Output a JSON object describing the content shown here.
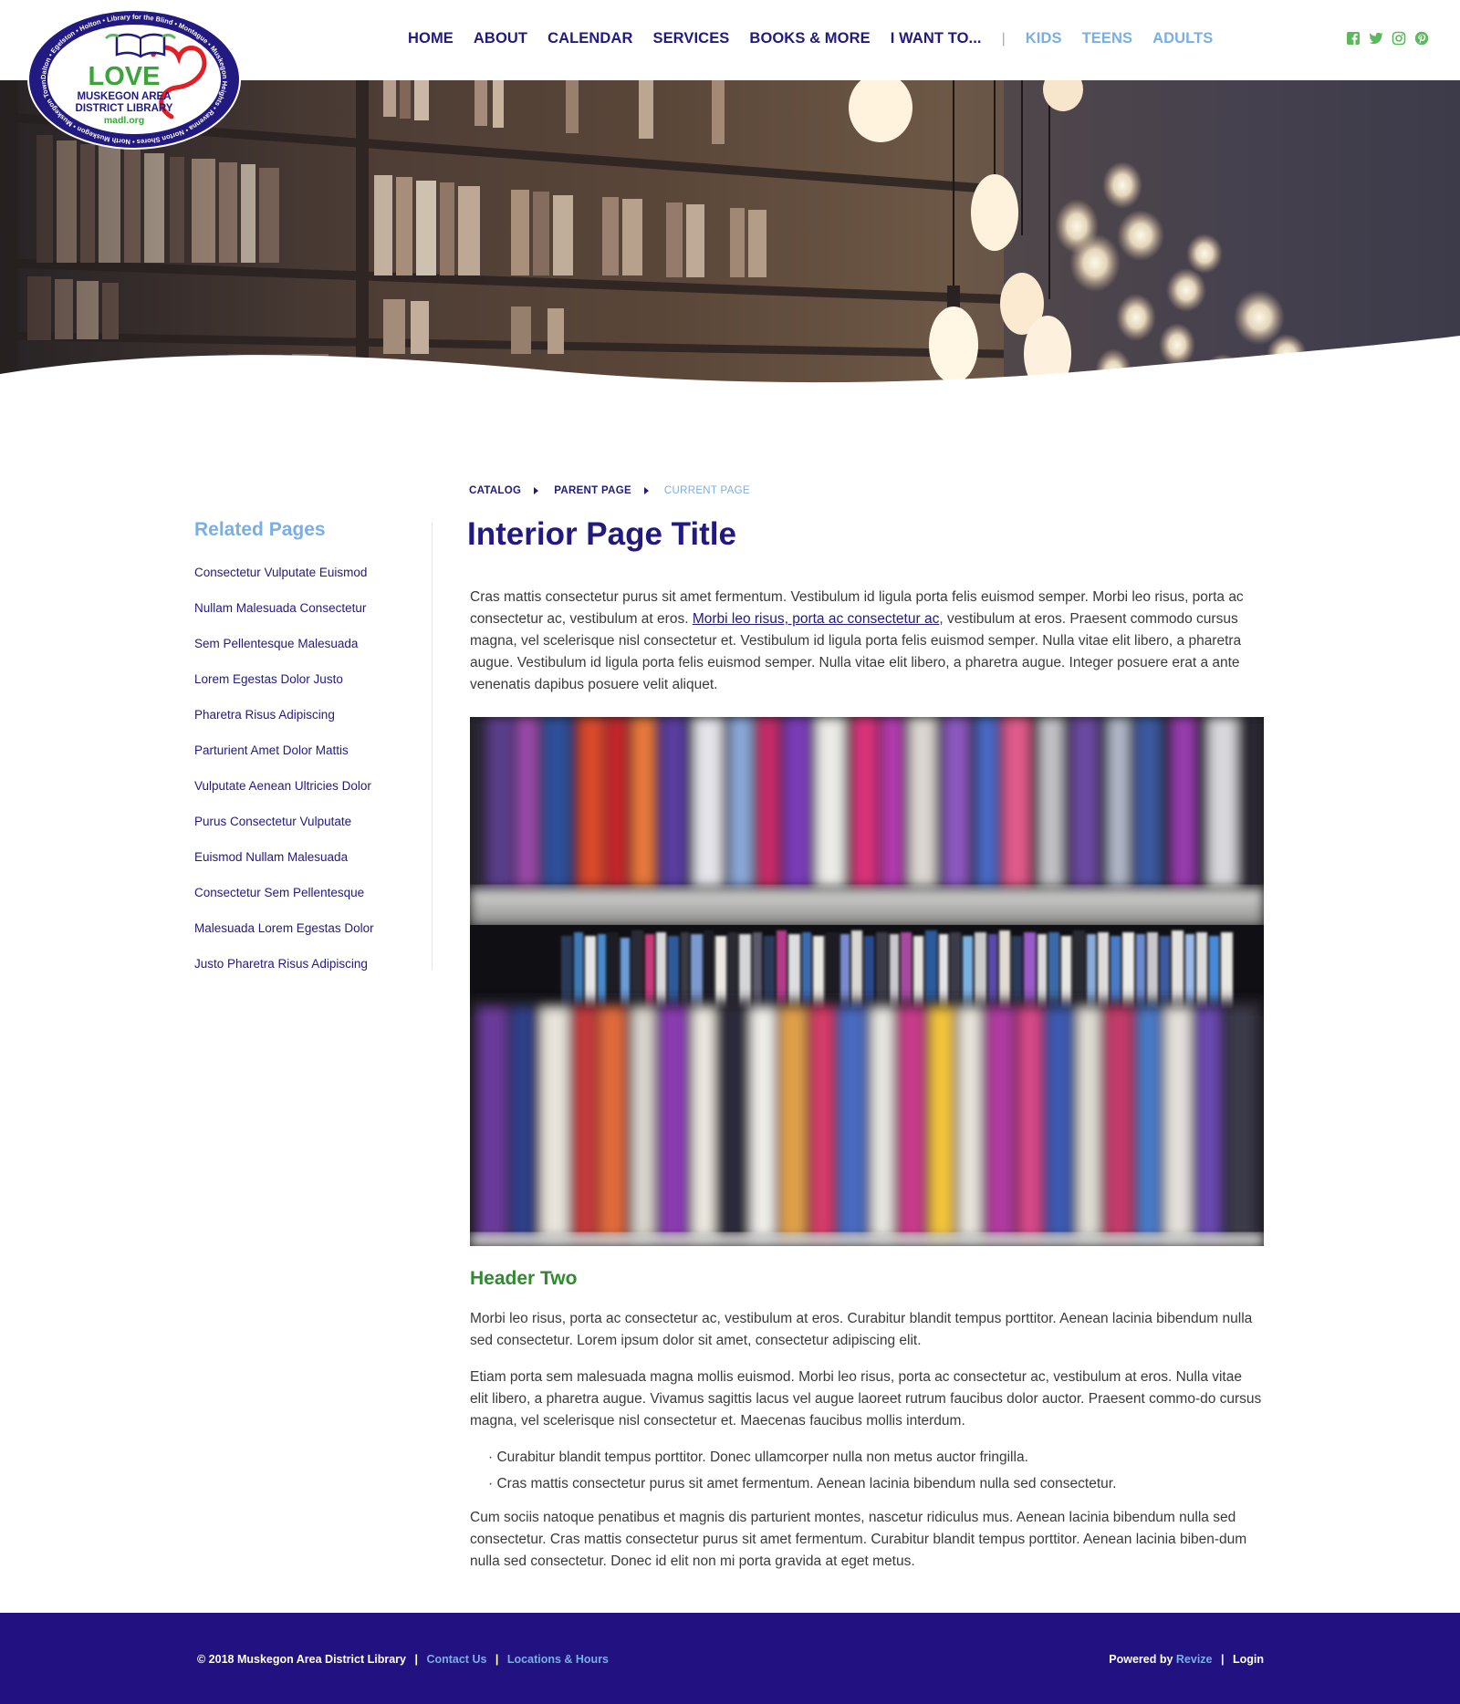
{
  "logo": {
    "main_word": "LOVE",
    "line1": "MUSKEGON AREA",
    "line2": "DISTRICT LIBRARY",
    "url": "madl.org",
    "ring_text": "Dalton • Egelston • Holton • Library for the Blind • Montague • Muskegon Heights • Ravenna • Norton Shores • North Muskegon • Muskegon Township •"
  },
  "nav": {
    "items": [
      "HOME",
      "ABOUT",
      "CALENDAR",
      "SERVICES",
      "BOOKS & MORE",
      "I WANT TO..."
    ],
    "separator": "|",
    "audience": [
      "KIDS",
      "TEENS",
      "ADULTS"
    ]
  },
  "social": [
    "facebook-icon",
    "twitter-icon",
    "instagram-icon",
    "pinterest-icon"
  ],
  "sidebar": {
    "title": "Related Pages",
    "items": [
      "Consectetur Vulputate Euismod",
      "Nullam Malesuada Consectetur",
      "Sem Pellentesque Malesuada",
      "Lorem Egestas Dolor Justo",
      "Pharetra Risus Adipiscing",
      "Parturient Amet Dolor Mattis",
      "Vulputate Aenean Ultricies Dolor",
      "Purus Consectetur Vulputate",
      "Euismod Nullam Malesuada",
      "Consectetur Sem Pellentesque",
      "Malesuada Lorem Egestas Dolor",
      "Justo Pharetra Risus Adipiscing"
    ]
  },
  "breadcrumb": {
    "catalog": "CATALOG",
    "parent": "PARENT PAGE",
    "current": "CURRENT PAGE"
  },
  "main": {
    "title": "Interior Page Title",
    "p1_before": "Cras mattis consectetur purus sit amet fermentum. Vestibulum id ligula porta felis euismod semper. Morbi leo risus, porta ac consectetur ac, vestibulum at eros. ",
    "p1_link": "Morbi leo risus, porta ac consectetur ac",
    "p1_after": ", vestibulum at eros. Praesent commodo cursus magna, vel scelerisque nisl consectetur et. Vestibulum id ligula porta felis euismod semper. Nulla vitae elit libero, a pharetra augue. Vestibulum id ligula porta felis euismod semper. Nulla vitae elit libero, a pharetra augue. Integer posuere erat a ante venenatis dapibus posuere velit aliquet.",
    "header_two": "Header Two",
    "p2": "Morbi leo risus, porta ac consectetur ac, vestibulum at eros. Curabitur blandit tempus porttitor. Aenean lacinia bibendum nulla sed consectetur. Lorem ipsum dolor sit amet, consectetur adipiscing elit.",
    "p3": "Etiam porta sem malesuada magna mollis euismod. Morbi leo risus, porta ac consectetur ac, vestibulum at eros. Nulla vitae elit libero, a pharetra augue. Vivamus sagittis lacus vel augue laoreet rutrum faucibus dolor auctor. Praesent commo-do cursus magna, vel scelerisque nisl consectetur et. Maecenas faucibus mollis interdum.",
    "bullets": [
      "Curabitur blandit tempus porttitor. Donec ullamcorper nulla non metus auctor fringilla.",
      "Cras mattis consectetur purus sit amet fermentum. Aenean lacinia bibendum nulla sed consectetur."
    ],
    "p4": "Cum sociis natoque penatibus et magnis dis parturient montes, nascetur ridiculus mus. Aenean lacinia bibendum nulla sed consectetur. Cras mattis consectetur purus sit amet fermentum. Curabitur blandit tempus porttitor. Aenean lacinia biben-dum nulla sed consectetur. Donec id elit non mi porta gravida at eget metus."
  },
  "footer": {
    "copyright": "© 2018 Muskegon Area District Library",
    "contact": "Contact Us",
    "locations": "Locations & Hours",
    "separator": "|",
    "powered_by": "Powered by",
    "revize": "Revize",
    "login": "Login"
  },
  "colors": {
    "brand_navy": "#221a80",
    "light_blue": "#7aaee6",
    "green": "#2e8b2e",
    "footer_bg": "#221180",
    "social_green": "#5cb85c"
  }
}
